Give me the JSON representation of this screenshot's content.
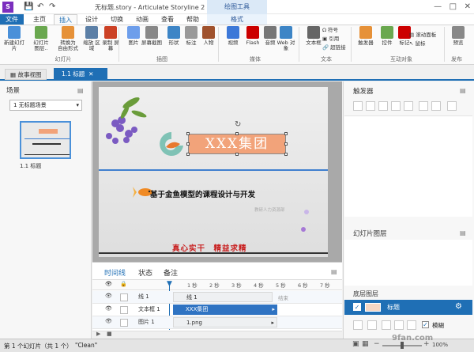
{
  "app": {
    "title": "无标题.story - Articulate Storyline 2",
    "logo_letter": "S",
    "drawing_tools_label": "绘图工具"
  },
  "menu": {
    "file": "文件",
    "tabs": [
      "主页",
      "插入",
      "设计",
      "切换",
      "动画",
      "查看",
      "帮助"
    ],
    "format": "格式"
  },
  "ribbon": {
    "buttons": [
      {
        "label": "新建幻灯片",
        "color": "#4a90d9"
      },
      {
        "label": "幻灯片 图层..",
        "color": "#6aa84f"
      },
      {
        "label": "转换为 自由形式",
        "color": "#e69138"
      },
      {
        "label": "缩放 区域",
        "color": "#5b7fa6"
      },
      {
        "label": "录制 屏幕",
        "color": "#cc4125"
      },
      {
        "label": "图片",
        "color": "#6d9eeb"
      },
      {
        "label": "屏幕截图",
        "color": "#888888"
      },
      {
        "label": "形状",
        "color": "#3d85c6"
      },
      {
        "label": "标注",
        "color": "#999999"
      },
      {
        "label": "人物",
        "color": "#a0522d"
      },
      {
        "label": "视频",
        "color": "#3c78d8"
      },
      {
        "label": "Flash",
        "color": "#cc0000"
      },
      {
        "label": "音频",
        "color": "#777777"
      },
      {
        "label": "Web 对象",
        "color": "#3d85c6"
      },
      {
        "label": "文本框",
        "color": "#666666"
      },
      {
        "label": "触发器",
        "color": "#e69138"
      },
      {
        "label": "控件",
        "color": "#6aa84f"
      },
      {
        "label": "标记",
        "color": "#cc0000"
      },
      {
        "label": "预览",
        "color": "#888888"
      }
    ],
    "small": [
      "符号",
      "引用",
      "超链接",
      "滚动面板",
      "鼠标"
    ],
    "groups": [
      "幻灯片",
      "插图",
      "媒体",
      "文本",
      "互动对象",
      "发布"
    ]
  },
  "doc_tabs": {
    "story_view": "故事视图",
    "slide": "1.1 标题"
  },
  "scenes": {
    "title": "场景",
    "selected": "1 无标题场景",
    "thumb_label": "1.1 标题"
  },
  "slide": {
    "title": "XXX集团",
    "subtitle": "基于金鱼模型的课程设计与开发",
    "author": "教研人力资源部",
    "motto": "真心实干　精益求精"
  },
  "timeline": {
    "tabs": [
      "时间线",
      "状态",
      "备注"
    ],
    "ticks": [
      "1 秒",
      "2 秒",
      "3 秒",
      "4 秒",
      "5 秒",
      "6 秒",
      "7 秒"
    ],
    "end_label": "结束",
    "rows": [
      {
        "name": "线 1",
        "bar": "线 1"
      },
      {
        "name": "文本框 1",
        "bar": "XXX集团"
      },
      {
        "name": "图片 1",
        "bar": "1.png"
      }
    ]
  },
  "right_panel": {
    "triggers_title": "触发器",
    "layers_title": "幻灯片图层",
    "base_layer": "底层图层",
    "layer_name": "标题",
    "dim_label": "模糊"
  },
  "status": {
    "slide_count": "第 1 个幻灯片（共 1 个）",
    "state": "\"Clean\"",
    "zoom": "100%",
    "watermark": "9fan.com"
  }
}
